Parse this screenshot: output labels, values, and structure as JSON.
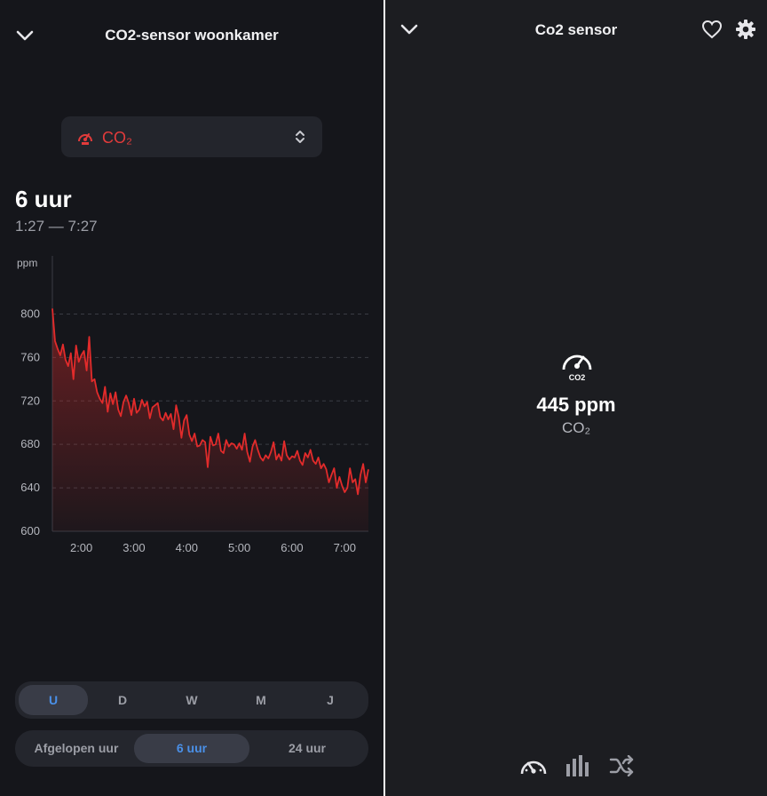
{
  "left": {
    "title": "CO2-sensor woonkamer",
    "selector_label": "CO₂",
    "range_title": "6 uur",
    "range_sub": "1:27 — 7:27",
    "period_tabs": [
      {
        "label": "U",
        "active": true
      },
      {
        "label": "D",
        "active": false
      },
      {
        "label": "W",
        "active": false
      },
      {
        "label": "M",
        "active": false
      },
      {
        "label": "J",
        "active": false
      }
    ],
    "range_tabs": [
      {
        "label": "Afgelopen uur",
        "active": false
      },
      {
        "label": "6 uur",
        "active": true
      },
      {
        "label": "24 uur",
        "active": false
      }
    ]
  },
  "right": {
    "title": "Co2 sensor",
    "value": "445 ppm",
    "unit_label": "CO₂",
    "gauge_badge": "CO2"
  },
  "colors": {
    "accent_red": "#e23b3b",
    "active_blue": "#4a90e8"
  },
  "icons": {
    "collapse": "chevron-down-icon",
    "favorite": "heart-icon",
    "settings": "gear-icon",
    "sensor": "gauge-icon",
    "history": "bar-chart-icon",
    "automations": "shuffle-icon"
  },
  "chart_data": {
    "type": "line",
    "ylabel": "ppm",
    "ylim": [
      600,
      820
    ],
    "yticks": [
      600,
      640,
      680,
      720,
      760,
      800
    ],
    "xticks": [
      "2:00",
      "3:00",
      "4:00",
      "5:00",
      "6:00",
      "7:00"
    ],
    "xlim_hours": [
      1.45,
      7.45
    ],
    "xtick_hours": [
      2,
      3,
      4,
      5,
      6,
      7
    ],
    "grid": true,
    "series": [
      {
        "x": [
          1.45,
          1.5,
          1.55,
          1.6,
          1.65,
          1.7,
          1.75,
          1.8,
          1.85,
          1.9,
          1.95,
          2.0,
          2.05,
          2.1,
          2.15,
          2.2,
          2.25,
          2.3,
          2.35,
          2.4,
          2.45,
          2.5,
          2.55,
          2.6,
          2.65,
          2.7,
          2.75,
          2.8,
          2.85,
          2.9,
          2.95,
          3.0,
          3.05,
          3.1,
          3.15,
          3.2,
          3.25,
          3.3,
          3.35,
          3.4,
          3.45,
          3.5,
          3.55,
          3.6,
          3.65,
          3.7,
          3.75,
          3.8,
          3.85,
          3.9,
          3.95,
          4.0,
          4.05,
          4.1,
          4.15,
          4.2,
          4.25,
          4.3,
          4.35,
          4.4,
          4.45,
          4.5,
          4.55,
          4.6,
          4.65,
          4.7,
          4.75,
          4.8,
          4.85,
          4.9,
          4.95,
          5.0,
          5.05,
          5.1,
          5.15,
          5.2,
          5.25,
          5.3,
          5.35,
          5.4,
          5.45,
          5.5,
          5.55,
          5.6,
          5.65,
          5.7,
          5.75,
          5.8,
          5.85,
          5.9,
          5.95,
          6.0,
          6.05,
          6.1,
          6.15,
          6.2,
          6.25,
          6.3,
          6.35,
          6.4,
          6.45,
          6.5,
          6.55,
          6.6,
          6.65,
          6.7,
          6.75,
          6.8,
          6.85,
          6.9,
          6.95,
          7.0,
          7.05,
          7.1,
          7.15,
          7.2,
          7.25,
          7.3,
          7.35,
          7.4,
          7.45
        ],
        "values": [
          805,
          775,
          768,
          762,
          772,
          758,
          752,
          764,
          740,
          771,
          756,
          762,
          766,
          748,
          779,
          738,
          740,
          728,
          722,
          718,
          733,
          710,
          727,
          717,
          728,
          712,
          706,
          719,
          725,
          718,
          707,
          722,
          709,
          712,
          721,
          715,
          719,
          704,
          714,
          716,
          718,
          705,
          702,
          709,
          703,
          708,
          694,
          716,
          705,
          686,
          702,
          707,
          689,
          683,
          690,
          678,
          679,
          684,
          682,
          659,
          687,
          679,
          680,
          690,
          674,
          672,
          684,
          678,
          681,
          680,
          676,
          681,
          675,
          690,
          673,
          664,
          678,
          684,
          675,
          668,
          665,
          670,
          667,
          673,
          682,
          666,
          671,
          665,
          683,
          670,
          666,
          669,
          668,
          674,
          665,
          661,
          672,
          668,
          675,
          665,
          662,
          668,
          658,
          662,
          657,
          645,
          652,
          658,
          640,
          650,
          642,
          636,
          640,
          658,
          645,
          648,
          634,
          652,
          662,
          645,
          657
        ]
      }
    ]
  }
}
